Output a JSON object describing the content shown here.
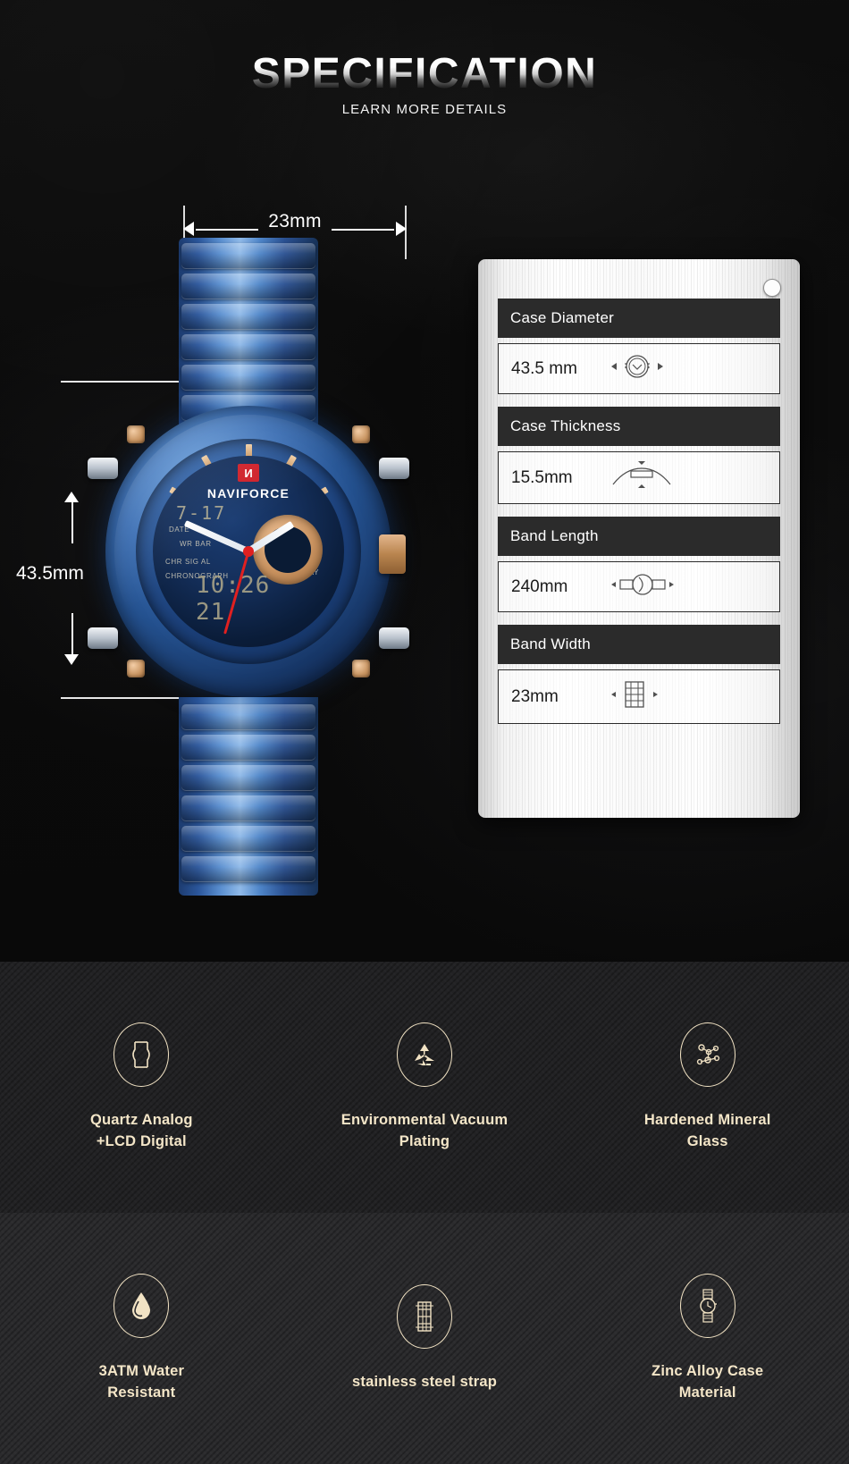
{
  "header": {
    "title": "SPECIFICATION",
    "subtitle": "LEARN MORE DETAILS"
  },
  "colors": {
    "background": "#0a0a0a",
    "band_1": "#222224",
    "band_2": "#2b2b2d",
    "accent_cream": "#f4e6c8",
    "spec_header_bar": "#2b2b2b",
    "logo_red": "#cf2029",
    "watch_blue": "#24518f",
    "rose_gold": "#c79360"
  },
  "dimensions": {
    "width_label": "23mm",
    "height_label": "43.5mm"
  },
  "watch": {
    "brand": "NAVIFORCE",
    "logo_mark": "И",
    "lcd_top": "7-17",
    "lcd_main": "10:26 21",
    "dial_texts": {
      "date": "DATE",
      "wr_bar": "WR BAR",
      "chr_sig_al": "CHR SIG AL",
      "chronograph": "CHRONOGRAPH",
      "day": "DAY"
    }
  },
  "spec_panel": {
    "rows": [
      {
        "label": "Case Diameter",
        "value": "43.5 mm",
        "icon": "watch-face-diameter-icon"
      },
      {
        "label": "Case Thickness",
        "value": "15.5mm",
        "icon": "watch-profile-thickness-icon"
      },
      {
        "label": "Band Length",
        "value": "240mm",
        "icon": "watch-band-length-icon"
      },
      {
        "label": "Band Width",
        "value": "23mm",
        "icon": "bracelet-width-icon"
      }
    ]
  },
  "features": {
    "row_1": [
      {
        "icon": "quartz-movement-icon",
        "line1": "Quartz Analog",
        "line2": "+LCD Digital"
      },
      {
        "icon": "recycle-icon",
        "line1": "Environmental Vacuum",
        "line2": "Plating"
      },
      {
        "icon": "molecule-icon",
        "line1": "Hardened Mineral",
        "line2": "Glass"
      }
    ],
    "row_2": [
      {
        "icon": "water-drop-icon",
        "line1": "3ATM Water",
        "line2": "Resistant"
      },
      {
        "icon": "steel-strap-icon",
        "line1": "stainless steel strap",
        "line2": ""
      },
      {
        "icon": "wristwatch-icon",
        "line1": "Zinc Alloy Case",
        "line2": "Material"
      }
    ]
  }
}
